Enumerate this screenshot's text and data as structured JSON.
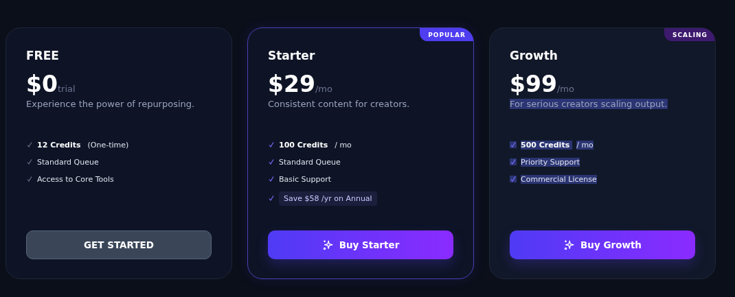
{
  "plans": [
    {
      "kind": "free",
      "name": "FREE",
      "price": "$0",
      "period": "trial",
      "description": "Experience the power of repurposing.",
      "featured": false,
      "highlighted": false,
      "features": [
        {
          "kind": "plain",
          "strong": "12 Credits",
          "text": "(One-time)"
        },
        {
          "kind": "plain",
          "text": "Standard Queue"
        },
        {
          "kind": "plain",
          "text": "Access to Core Tools"
        }
      ],
      "button": "GET STARTED"
    },
    {
      "kind": "paid",
      "name": "Starter",
      "price": "$29",
      "period": "/mo",
      "description": "Consistent content for creators.",
      "featured": true,
      "highlighted": false,
      "badge": {
        "kind": "popular",
        "label": "POPULAR"
      },
      "features": [
        {
          "kind": "plain",
          "strong": "100 Credits",
          "text": "/ mo"
        },
        {
          "kind": "plain",
          "text": "Standard Queue"
        },
        {
          "kind": "plain",
          "text": "Basic Support"
        },
        {
          "kind": "offer",
          "text": "Save $58 /yr on Annual"
        }
      ],
      "button": "Buy Starter"
    },
    {
      "kind": "paid",
      "name": "Growth",
      "price": "$99",
      "period": "/mo",
      "description": "For serious creators scaling output.",
      "featured": false,
      "highlighted": true,
      "badge": {
        "kind": "scaling",
        "label": "SCALING"
      },
      "features": [
        {
          "kind": "plain",
          "strong": "500 Credits",
          "text": "/ mo"
        },
        {
          "kind": "plain",
          "text": "Priority Support"
        },
        {
          "kind": "plain",
          "text": "Commercial License"
        }
      ],
      "button": "Buy Growth"
    }
  ]
}
